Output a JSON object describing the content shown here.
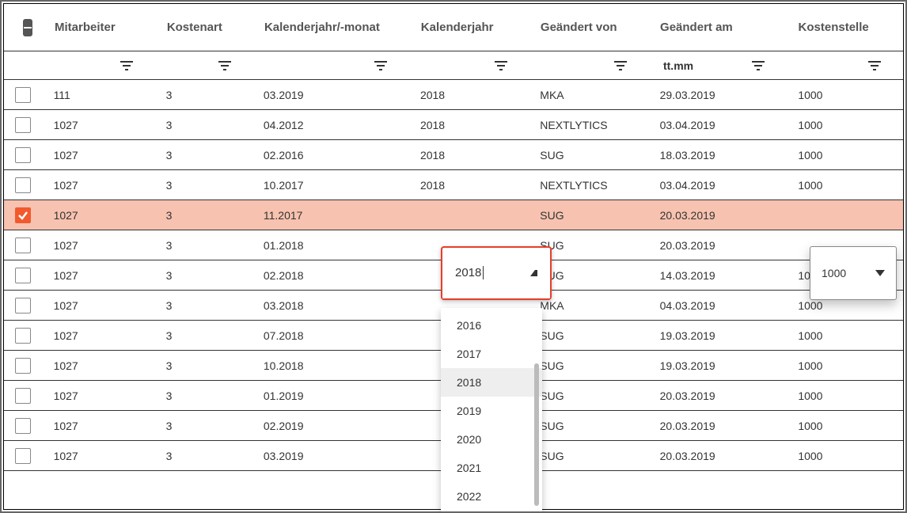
{
  "columns": {
    "mitarbeiter": "Mitarbeiter",
    "kostenart": "Kostenart",
    "kalenderjahr_monat": "Kalenderjahr/-monat",
    "kalenderjahr": "Kalenderjahr",
    "geaendert_von": "Geändert von",
    "geaendert_am": "Geändert am",
    "kostenstelle": "Kostenstelle"
  },
  "filter_row": {
    "date_placeholder": "tt.mm"
  },
  "rows": [
    {
      "checked": false,
      "mitarbeiter": "111",
      "kostenart": "3",
      "kjm": "03.2019",
      "kj": "2018",
      "gvon": "MKA",
      "gam": "29.03.2019",
      "kst": "1000"
    },
    {
      "checked": false,
      "mitarbeiter": "1027",
      "kostenart": "3",
      "kjm": "04.2012",
      "kj": "2018",
      "gvon": "NEXTLYTICS",
      "gam": "03.04.2019",
      "kst": "1000"
    },
    {
      "checked": false,
      "mitarbeiter": "1027",
      "kostenart": "3",
      "kjm": "02.2016",
      "kj": "2018",
      "gvon": "SUG",
      "gam": "18.03.2019",
      "kst": "1000"
    },
    {
      "checked": false,
      "mitarbeiter": "1027",
      "kostenart": "3",
      "kjm": "10.2017",
      "kj": "2018",
      "gvon": "NEXTLYTICS",
      "gam": "03.04.2019",
      "kst": "1000"
    },
    {
      "checked": true,
      "mitarbeiter": "1027",
      "kostenart": "3",
      "kjm": "11.2017",
      "kj": "",
      "gvon": "SUG",
      "gam": "20.03.2019",
      "kst": ""
    },
    {
      "checked": false,
      "mitarbeiter": "1027",
      "kostenart": "3",
      "kjm": "01.2018",
      "kj": "",
      "gvon": "SUG",
      "gam": "20.03.2019",
      "kst": ""
    },
    {
      "checked": false,
      "mitarbeiter": "1027",
      "kostenart": "3",
      "kjm": "02.2018",
      "kj": "",
      "gvon": "SUG",
      "gam": "14.03.2019",
      "kst": "1000"
    },
    {
      "checked": false,
      "mitarbeiter": "1027",
      "kostenart": "3",
      "kjm": "03.2018",
      "kj": "",
      "gvon": "MKA",
      "gam": "04.03.2019",
      "kst": "1000"
    },
    {
      "checked": false,
      "mitarbeiter": "1027",
      "kostenart": "3",
      "kjm": "07.2018",
      "kj": "",
      "gvon": "SUG",
      "gam": "19.03.2019",
      "kst": "1000"
    },
    {
      "checked": false,
      "mitarbeiter": "1027",
      "kostenart": "3",
      "kjm": "10.2018",
      "kj": "",
      "gvon": "SUG",
      "gam": "19.03.2019",
      "kst": "1000"
    },
    {
      "checked": false,
      "mitarbeiter": "1027",
      "kostenart": "3",
      "kjm": "01.2019",
      "kj": "",
      "gvon": "SUG",
      "gam": "20.03.2019",
      "kst": "1000"
    },
    {
      "checked": false,
      "mitarbeiter": "1027",
      "kostenart": "3",
      "kjm": "02.2019",
      "kj": "",
      "gvon": "SUG",
      "gam": "20.03.2019",
      "kst": "1000"
    },
    {
      "checked": false,
      "mitarbeiter": "1027",
      "kostenart": "3",
      "kjm": "03.2019",
      "kj": "",
      "gvon": "SUG",
      "gam": "20.03.2019",
      "kst": "1000"
    }
  ],
  "year_dropdown": {
    "input_value": "2018",
    "options": [
      "2016",
      "2017",
      "2018",
      "2019",
      "2020",
      "2021",
      "2022"
    ],
    "selected": "2018"
  },
  "kst_dropdown": {
    "value": "1000"
  }
}
